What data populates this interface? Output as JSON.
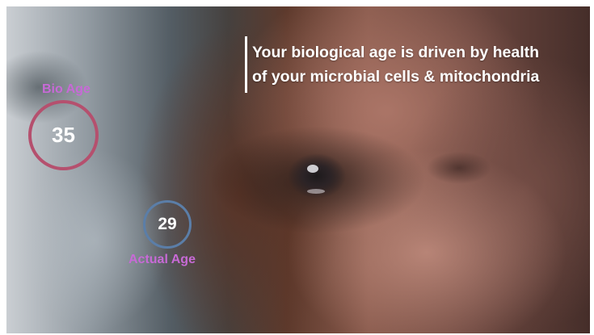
{
  "headline": {
    "line1": "Your biological age is driven by health",
    "line2": "of your microbial cells & mitochondria"
  },
  "bio_age": {
    "label": "Bio Age",
    "value": "35",
    "ring_color": "#b5506e"
  },
  "actual_age": {
    "label": "Actual Age",
    "value": "29",
    "ring_color": "#5b7ea8"
  },
  "colors": {
    "label_accent": "#c76ad6",
    "text": "#ffffff"
  }
}
